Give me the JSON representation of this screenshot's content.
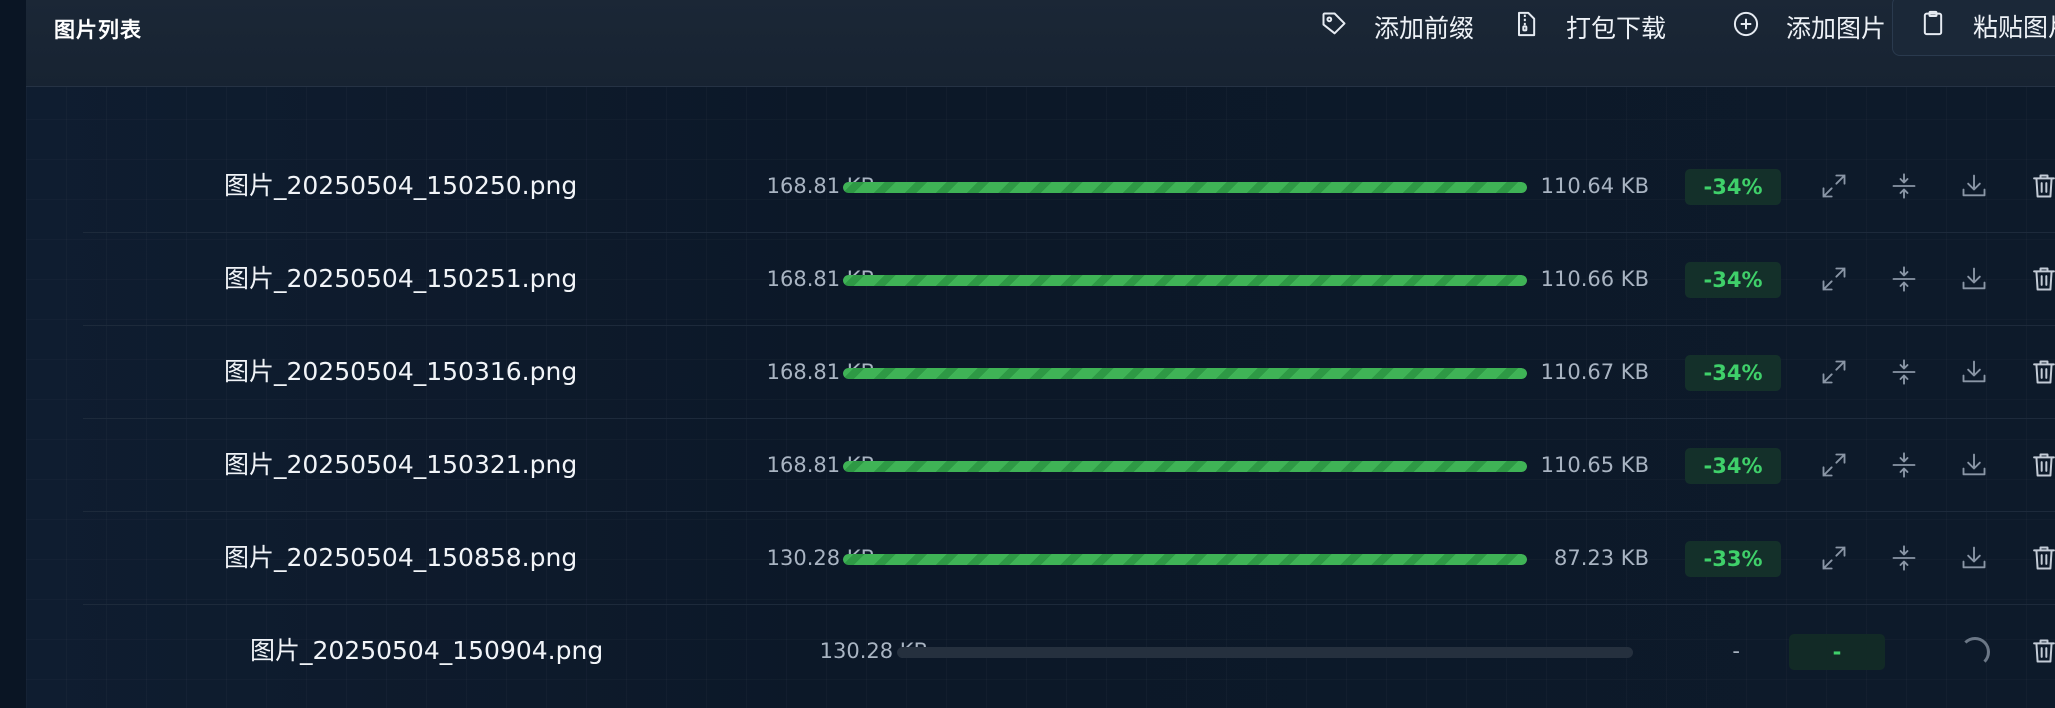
{
  "header": {
    "title": "图片列表",
    "actions": {
      "add_prefix": "添加前缀",
      "pack_download": "打包下载",
      "add_image": "添加图片",
      "paste_image": "粘贴图片"
    }
  },
  "colors": {
    "progress": "#3fb356",
    "badge_text": "#3fd06a",
    "badge_bg": "#14302a",
    "background": "#0d1a2b"
  },
  "icons": {
    "add_prefix": "tag-icon",
    "pack_download": "zip-file-icon",
    "add_image": "plus-circle-icon",
    "paste_image": "clipboard-icon",
    "row_actions": [
      "expand-icon",
      "compress-icon",
      "download-icon",
      "trash-icon"
    ],
    "pending": "loading-spinner-icon"
  },
  "files": [
    {
      "name": "图片_20250504_150250.png",
      "original_size": "168.81 KB",
      "progress": 1.0,
      "compressed_size": "110.64 KB",
      "ratio": "-34%"
    },
    {
      "name": "图片_20250504_150251.png",
      "original_size": "168.81 KB",
      "progress": 1.0,
      "compressed_size": "110.66 KB",
      "ratio": "-34%"
    },
    {
      "name": "图片_20250504_150316.png",
      "original_size": "168.81 KB",
      "progress": 1.0,
      "compressed_size": "110.67 KB",
      "ratio": "-34%"
    },
    {
      "name": "图片_20250504_150321.png",
      "original_size": "168.81 KB",
      "progress": 1.0,
      "compressed_size": "110.65 KB",
      "ratio": "-34%"
    },
    {
      "name": "图片_20250504_150858.png",
      "original_size": "130.28 KB",
      "progress": 1.0,
      "compressed_size": "87.23 KB",
      "ratio": "-33%"
    },
    {
      "name": "图片_20250504_150904.png",
      "original_size": "130.28 KB",
      "progress": 0.0,
      "compressed_size": "-",
      "ratio": "-"
    }
  ]
}
